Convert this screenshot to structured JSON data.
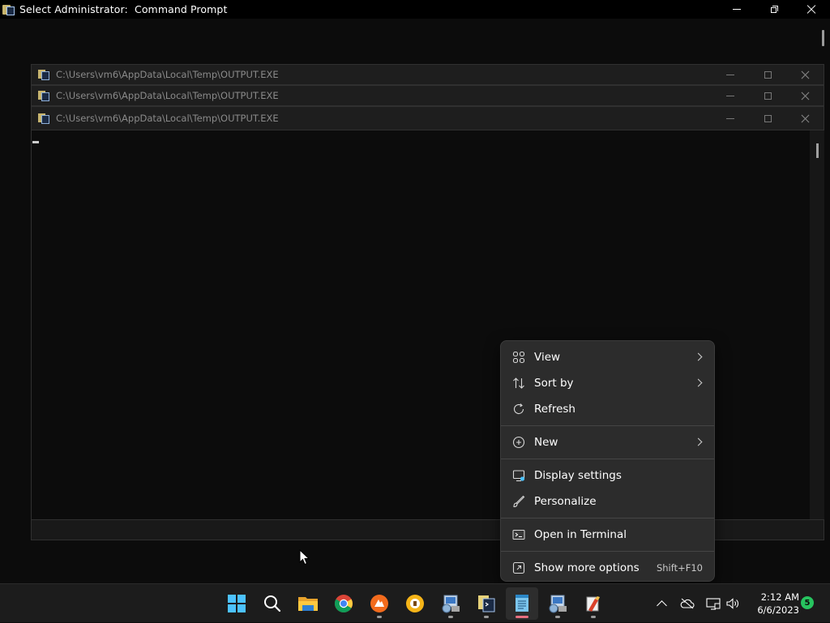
{
  "main_window": {
    "title": "Select Administrator:  Command Prompt"
  },
  "output_windows": [
    {
      "title": "C:\\Users\\vm6\\AppData\\Local\\Temp\\OUTPUT.EXE"
    },
    {
      "title": "C:\\Users\\vm6\\AppData\\Local\\Temp\\OUTPUT.EXE"
    },
    {
      "title": "C:\\Users\\vm6\\AppData\\Local\\Temp\\OUTPUT.EXE"
    }
  ],
  "context_menu": {
    "items": [
      {
        "label": "View",
        "icon": "grid-icon",
        "submenu": true
      },
      {
        "label": "Sort by",
        "icon": "sort-icon",
        "submenu": true
      },
      {
        "label": "Refresh",
        "icon": "refresh-icon",
        "submenu": false
      },
      {
        "label": "New",
        "icon": "plus-circle-icon",
        "submenu": true
      },
      {
        "label": "Display settings",
        "icon": "display-icon",
        "submenu": false
      },
      {
        "label": "Personalize",
        "icon": "brush-icon",
        "submenu": false
      },
      {
        "label": "Open in Terminal",
        "icon": "terminal-icon",
        "submenu": false
      },
      {
        "label": "Show more options",
        "icon": "share-icon",
        "shortcut": "Shift+F10",
        "submenu": false
      }
    ]
  },
  "taskbar": {
    "apps": [
      {
        "name": "start-button",
        "icon": "windows-logo-icon",
        "running": false
      },
      {
        "name": "search-button",
        "icon": "search-icon",
        "running": false
      },
      {
        "name": "file-explorer",
        "icon": "folder-icon",
        "running": false
      },
      {
        "name": "chrome",
        "icon": "chrome-icon",
        "running": false
      },
      {
        "name": "app-orange",
        "icon": "orange-app-icon",
        "running": true
      },
      {
        "name": "app-yellow",
        "icon": "yellow-app-icon",
        "running": false
      },
      {
        "name": "app-setup-1",
        "icon": "setup-icon",
        "running": true
      },
      {
        "name": "app-cmd",
        "icon": "cmd-icon",
        "running": true
      },
      {
        "name": "app-notepad",
        "icon": "notepad-icon",
        "running": true,
        "active": true
      },
      {
        "name": "app-setup-2",
        "icon": "setup-icon",
        "running": true
      },
      {
        "name": "app-tool",
        "icon": "tool-icon",
        "running": true
      }
    ],
    "time": "2:12 AM",
    "date": "6/6/2023",
    "notification_count": "5"
  },
  "colors": {
    "accent_blue": "#4cc2ff",
    "active_indicator": "#e87080",
    "notification_green": "#27c45f"
  }
}
